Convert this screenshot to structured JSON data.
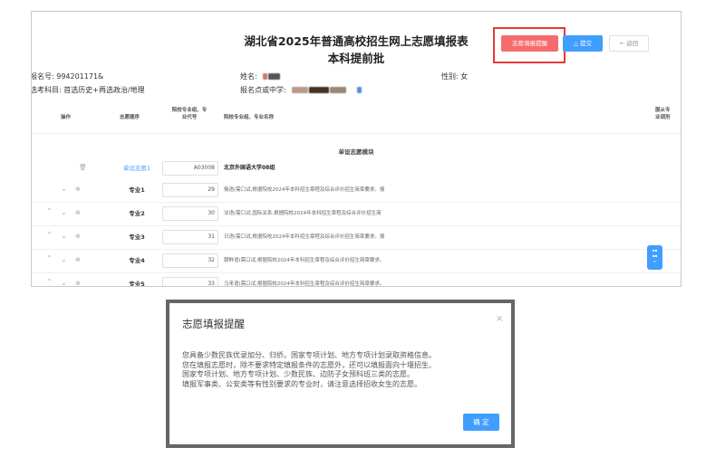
{
  "header": {
    "title_line1": "湖北省2025年普通高校招生网上志愿填报表",
    "title_line2": "本科提前批"
  },
  "actions": {
    "reminder_label": "志愿填报提醒",
    "submit_label": "△ 提交",
    "back_label": "← 返回"
  },
  "info": {
    "reg_no": "报名号: 994201171&",
    "subjects": "选考科目:  首选历史+再选政治/地理",
    "name_label": "姓名:",
    "school_label": "报名点或中学:",
    "gender": "性别: 女"
  },
  "table": {
    "col_op": "操作",
    "col_order": "志愿顺序",
    "col_code_1": "院校专业组、专",
    "col_code_2": "业代号",
    "col_name": "院校专业组、专业名称",
    "col_adjust_1": "服从专",
    "col_adjust_2": "业调剂"
  },
  "section_title": "单设志愿模块",
  "rows": [
    {
      "order": "单设志愿1",
      "code": "A03008",
      "name": "北京外国语大学08组"
    },
    {
      "order": "专业1",
      "code": "29",
      "name": "俄语(需口试,根据院校2024年本科招生章程及综合评价招生简章要求。报"
    },
    {
      "order": "专业2",
      "code": "30",
      "name": "法语(需口试,国际关系,根据院校2024年本科招生章程及综合评价招生简"
    },
    {
      "order": "专业3",
      "code": "31",
      "name": "日语(需口试,根据院校2024年本科招生章程及综合评价招生简章要求。报"
    },
    {
      "order": "专业4",
      "code": "32",
      "name": "朝鲜语(需口试,根据院校2024年本科招生章程及综合评价招生简章要求。"
    },
    {
      "order": "专业5",
      "code": "33",
      "name": "马来语(需口试,根据院校2024年本科招生章程及综合评价招生简章要求。"
    }
  ],
  "modal": {
    "title": "志愿填报提醒",
    "close": "×",
    "line1": "您具备少数民族优录加分、归侨。国家专项计划、地方专项计划录取资格信息。",
    "line2": "您在填报志愿时，除不要求特定填报条件的志愿外，还可以填报面向十堰招生、",
    "line3": "国家专项计划、地方专项计划、少数民族、边防子女预科班三类的志愿。",
    "line4": "填报军事类、公安类等有性别要求的专业时，请注意选择招收女生的志愿。",
    "ok": "确 定"
  },
  "colors": {
    "primary": "#409eff",
    "danger": "#f56c6c",
    "highlight": "#e53935"
  }
}
